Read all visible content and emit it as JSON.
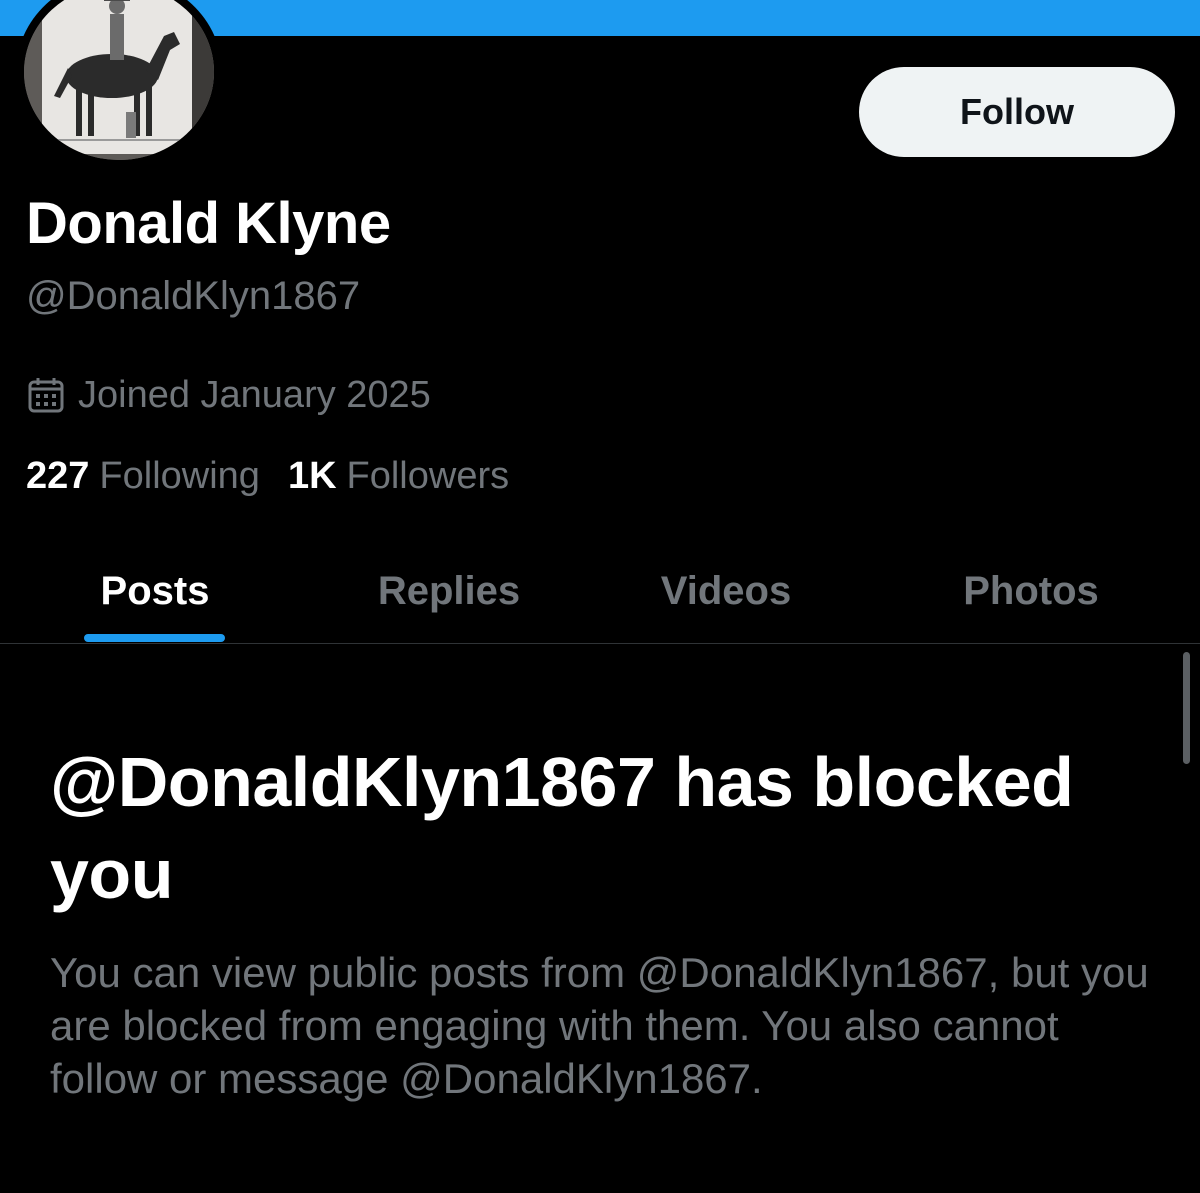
{
  "colors": {
    "banner": "#1d9bf0",
    "accent": "#1d9bf0",
    "background": "#000000",
    "primary_text": "#ffffff",
    "secondary_text": "#71767b",
    "follow_button_bg": "#eff3f4"
  },
  "profile": {
    "avatar_icon": "profile-photo-horse-rider-drawing",
    "display_name": "Donald Klyne",
    "handle": "@DonaldKlyn1867",
    "joined_icon": "calendar-icon",
    "joined_text": "Joined January 2025",
    "following_count": "227",
    "following_label": "Following",
    "followers_count": "1K",
    "followers_label": "Followers"
  },
  "actions": {
    "follow_label": "Follow"
  },
  "tabs": [
    {
      "label": "Posts",
      "active": true
    },
    {
      "label": "Replies",
      "active": false
    },
    {
      "label": "Videos",
      "active": false
    },
    {
      "label": "Photos",
      "active": false
    }
  ],
  "blocked": {
    "title": "@DonaldKlyn1867 has blocked you",
    "description": "You can view public posts from @DonaldKlyn1867, but you are blocked from engaging with them. You also cannot follow or message @DonaldKlyn1867."
  }
}
